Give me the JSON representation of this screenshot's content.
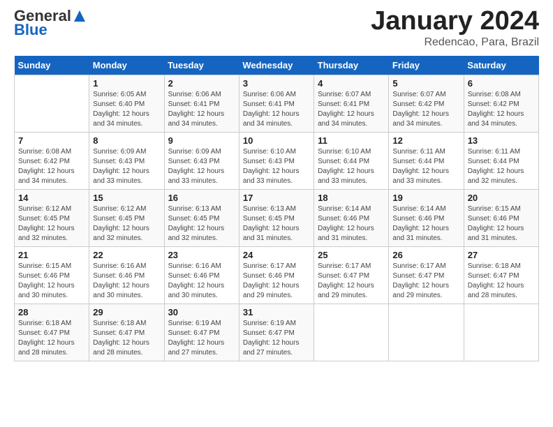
{
  "header": {
    "logo_general": "General",
    "logo_blue": "Blue",
    "title": "January 2024",
    "location": "Redencao, Para, Brazil"
  },
  "days_of_week": [
    "Sunday",
    "Monday",
    "Tuesday",
    "Wednesday",
    "Thursday",
    "Friday",
    "Saturday"
  ],
  "weeks": [
    [
      {
        "day": "",
        "info": ""
      },
      {
        "day": "1",
        "info": "Sunrise: 6:05 AM\nSunset: 6:40 PM\nDaylight: 12 hours\nand 34 minutes."
      },
      {
        "day": "2",
        "info": "Sunrise: 6:06 AM\nSunset: 6:41 PM\nDaylight: 12 hours\nand 34 minutes."
      },
      {
        "day": "3",
        "info": "Sunrise: 6:06 AM\nSunset: 6:41 PM\nDaylight: 12 hours\nand 34 minutes."
      },
      {
        "day": "4",
        "info": "Sunrise: 6:07 AM\nSunset: 6:41 PM\nDaylight: 12 hours\nand 34 minutes."
      },
      {
        "day": "5",
        "info": "Sunrise: 6:07 AM\nSunset: 6:42 PM\nDaylight: 12 hours\nand 34 minutes."
      },
      {
        "day": "6",
        "info": "Sunrise: 6:08 AM\nSunset: 6:42 PM\nDaylight: 12 hours\nand 34 minutes."
      }
    ],
    [
      {
        "day": "7",
        "info": "Sunrise: 6:08 AM\nSunset: 6:42 PM\nDaylight: 12 hours\nand 34 minutes."
      },
      {
        "day": "8",
        "info": "Sunrise: 6:09 AM\nSunset: 6:43 PM\nDaylight: 12 hours\nand 33 minutes."
      },
      {
        "day": "9",
        "info": "Sunrise: 6:09 AM\nSunset: 6:43 PM\nDaylight: 12 hours\nand 33 minutes."
      },
      {
        "day": "10",
        "info": "Sunrise: 6:10 AM\nSunset: 6:43 PM\nDaylight: 12 hours\nand 33 minutes."
      },
      {
        "day": "11",
        "info": "Sunrise: 6:10 AM\nSunset: 6:44 PM\nDaylight: 12 hours\nand 33 minutes."
      },
      {
        "day": "12",
        "info": "Sunrise: 6:11 AM\nSunset: 6:44 PM\nDaylight: 12 hours\nand 33 minutes."
      },
      {
        "day": "13",
        "info": "Sunrise: 6:11 AM\nSunset: 6:44 PM\nDaylight: 12 hours\nand 32 minutes."
      }
    ],
    [
      {
        "day": "14",
        "info": "Sunrise: 6:12 AM\nSunset: 6:45 PM\nDaylight: 12 hours\nand 32 minutes."
      },
      {
        "day": "15",
        "info": "Sunrise: 6:12 AM\nSunset: 6:45 PM\nDaylight: 12 hours\nand 32 minutes."
      },
      {
        "day": "16",
        "info": "Sunrise: 6:13 AM\nSunset: 6:45 PM\nDaylight: 12 hours\nand 32 minutes."
      },
      {
        "day": "17",
        "info": "Sunrise: 6:13 AM\nSunset: 6:45 PM\nDaylight: 12 hours\nand 31 minutes."
      },
      {
        "day": "18",
        "info": "Sunrise: 6:14 AM\nSunset: 6:46 PM\nDaylight: 12 hours\nand 31 minutes."
      },
      {
        "day": "19",
        "info": "Sunrise: 6:14 AM\nSunset: 6:46 PM\nDaylight: 12 hours\nand 31 minutes."
      },
      {
        "day": "20",
        "info": "Sunrise: 6:15 AM\nSunset: 6:46 PM\nDaylight: 12 hours\nand 31 minutes."
      }
    ],
    [
      {
        "day": "21",
        "info": "Sunrise: 6:15 AM\nSunset: 6:46 PM\nDaylight: 12 hours\nand 30 minutes."
      },
      {
        "day": "22",
        "info": "Sunrise: 6:16 AM\nSunset: 6:46 PM\nDaylight: 12 hours\nand 30 minutes."
      },
      {
        "day": "23",
        "info": "Sunrise: 6:16 AM\nSunset: 6:46 PM\nDaylight: 12 hours\nand 30 minutes."
      },
      {
        "day": "24",
        "info": "Sunrise: 6:17 AM\nSunset: 6:46 PM\nDaylight: 12 hours\nand 29 minutes."
      },
      {
        "day": "25",
        "info": "Sunrise: 6:17 AM\nSunset: 6:47 PM\nDaylight: 12 hours\nand 29 minutes."
      },
      {
        "day": "26",
        "info": "Sunrise: 6:17 AM\nSunset: 6:47 PM\nDaylight: 12 hours\nand 29 minutes."
      },
      {
        "day": "27",
        "info": "Sunrise: 6:18 AM\nSunset: 6:47 PM\nDaylight: 12 hours\nand 28 minutes."
      }
    ],
    [
      {
        "day": "28",
        "info": "Sunrise: 6:18 AM\nSunset: 6:47 PM\nDaylight: 12 hours\nand 28 minutes."
      },
      {
        "day": "29",
        "info": "Sunrise: 6:18 AM\nSunset: 6:47 PM\nDaylight: 12 hours\nand 28 minutes."
      },
      {
        "day": "30",
        "info": "Sunrise: 6:19 AM\nSunset: 6:47 PM\nDaylight: 12 hours\nand 27 minutes."
      },
      {
        "day": "31",
        "info": "Sunrise: 6:19 AM\nSunset: 6:47 PM\nDaylight: 12 hours\nand 27 minutes."
      },
      {
        "day": "",
        "info": ""
      },
      {
        "day": "",
        "info": ""
      },
      {
        "day": "",
        "info": ""
      }
    ]
  ]
}
